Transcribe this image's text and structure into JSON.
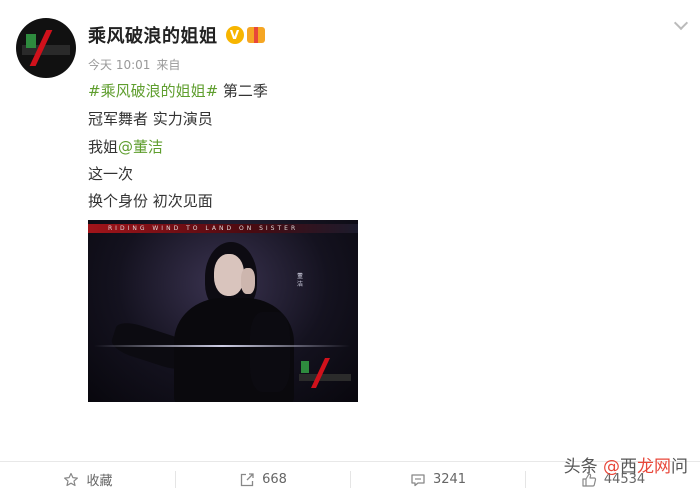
{
  "post": {
    "author_name": "乘风破浪的姐姐",
    "verified_mark": "V",
    "meta_time": "今天 10:01",
    "meta_source": "来自",
    "lines": {
      "topic": "#乘风破浪的姐姐#",
      "topic_suffix": " 第二季",
      "line2": "冠军舞者 实力演员",
      "line3_prefix": "我姐",
      "mention": "@董洁",
      "line4": "这一次",
      "line5": "换个身份 初次见面"
    },
    "image_overlay": {
      "ribbon_text": "RIDING WIND TO LAND ON SISTER",
      "vertical_text": "董洁"
    }
  },
  "actions": {
    "favorite_label": "收藏",
    "repost_count": "668",
    "comment_count": "3241",
    "like_count": "44534"
  },
  "watermark": {
    "prefix": "头条",
    "brand_1": "@",
    "brand_2": "西",
    "brand_3": "龙网",
    "suffix": "问"
  },
  "colors": {
    "topic_green": "#5f9e2e",
    "brand_red": "#d0111b",
    "verified_gold": "#f7b500"
  },
  "icons": [
    "avatar-logo",
    "verified-icon",
    "gift-icon",
    "chevron-down-icon",
    "star-icon",
    "repost-icon",
    "comment-icon",
    "like-icon"
  ]
}
